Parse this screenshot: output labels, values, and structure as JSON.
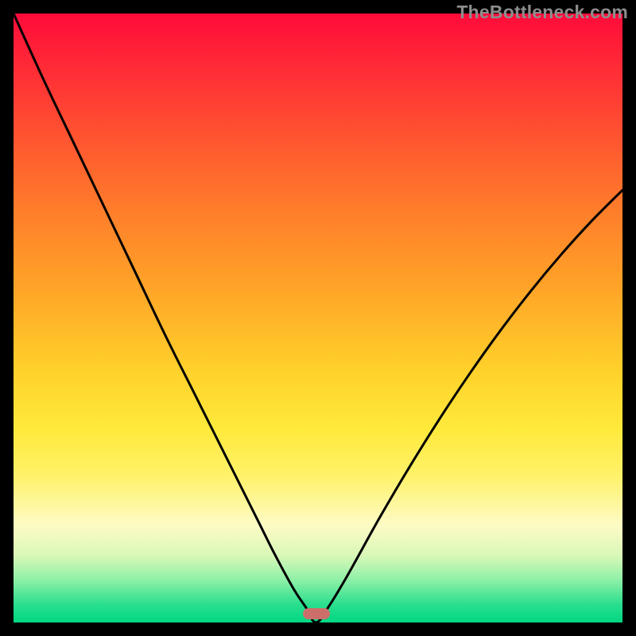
{
  "watermark": "TheBottleneck.com",
  "marker": {
    "x_frac": 0.497,
    "y_frac": 0.986,
    "color": "#cc6f6a"
  },
  "chart_data": {
    "type": "line",
    "title": "",
    "xlabel": "",
    "ylabel": "",
    "xlim": [
      0,
      1
    ],
    "ylim": [
      0,
      1
    ],
    "note": "No axis ticks or numeric labels are visible; values are normalized fractions of the plot area (origin at bottom-left).",
    "series": [
      {
        "name": "curve",
        "x": [
          0.0,
          0.05,
          0.1,
          0.15,
          0.2,
          0.25,
          0.3,
          0.35,
          0.4,
          0.43,
          0.46,
          0.48,
          0.497,
          0.52,
          0.55,
          0.6,
          0.65,
          0.7,
          0.75,
          0.8,
          0.85,
          0.9,
          0.95,
          1.0
        ],
        "y": [
          1.0,
          0.89,
          0.785,
          0.68,
          0.575,
          0.47,
          0.37,
          0.27,
          0.17,
          0.11,
          0.055,
          0.025,
          0.0,
          0.03,
          0.08,
          0.17,
          0.255,
          0.335,
          0.41,
          0.48,
          0.545,
          0.605,
          0.66,
          0.71
        ]
      }
    ],
    "background_gradient_stops": [
      {
        "pos": 0.0,
        "color": "#ff0b3a"
      },
      {
        "pos": 0.1,
        "color": "#ff2f36"
      },
      {
        "pos": 0.22,
        "color": "#ff5a2f"
      },
      {
        "pos": 0.33,
        "color": "#ff7f2a"
      },
      {
        "pos": 0.45,
        "color": "#ffa428"
      },
      {
        "pos": 0.58,
        "color": "#ffcf2a"
      },
      {
        "pos": 0.68,
        "color": "#ffe93a"
      },
      {
        "pos": 0.76,
        "color": "#fff26a"
      },
      {
        "pos": 0.84,
        "color": "#fdfbc5"
      },
      {
        "pos": 0.89,
        "color": "#d9f8b8"
      },
      {
        "pos": 0.93,
        "color": "#8ef0a7"
      },
      {
        "pos": 0.97,
        "color": "#2adf8e"
      },
      {
        "pos": 1.0,
        "color": "#00d783"
      }
    ]
  }
}
